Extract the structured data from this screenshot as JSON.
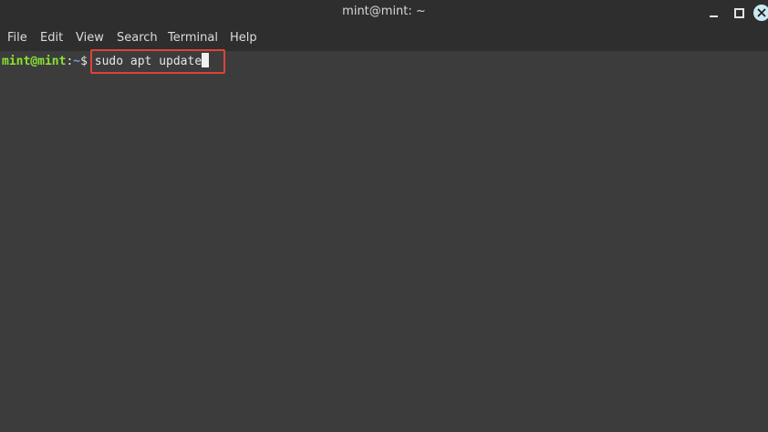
{
  "window": {
    "title": "mint@mint: ~"
  },
  "controls": {
    "minimize_icon": "minimize-icon",
    "maximize_icon": "maximize-icon",
    "close_icon": "close-icon"
  },
  "menu": {
    "items": [
      "File",
      "Edit",
      "View",
      "Search",
      "Terminal",
      "Help"
    ]
  },
  "terminal": {
    "prompt_user": "mint@mint",
    "prompt_sep": ":",
    "prompt_path": "~",
    "prompt_dollar": "$ ",
    "command": "sudo apt update"
  },
  "colors": {
    "background": "#3c3c3c",
    "prompt_user": "#8ae234",
    "prompt_path": "#729fcf",
    "highlight": "#e0413a"
  }
}
